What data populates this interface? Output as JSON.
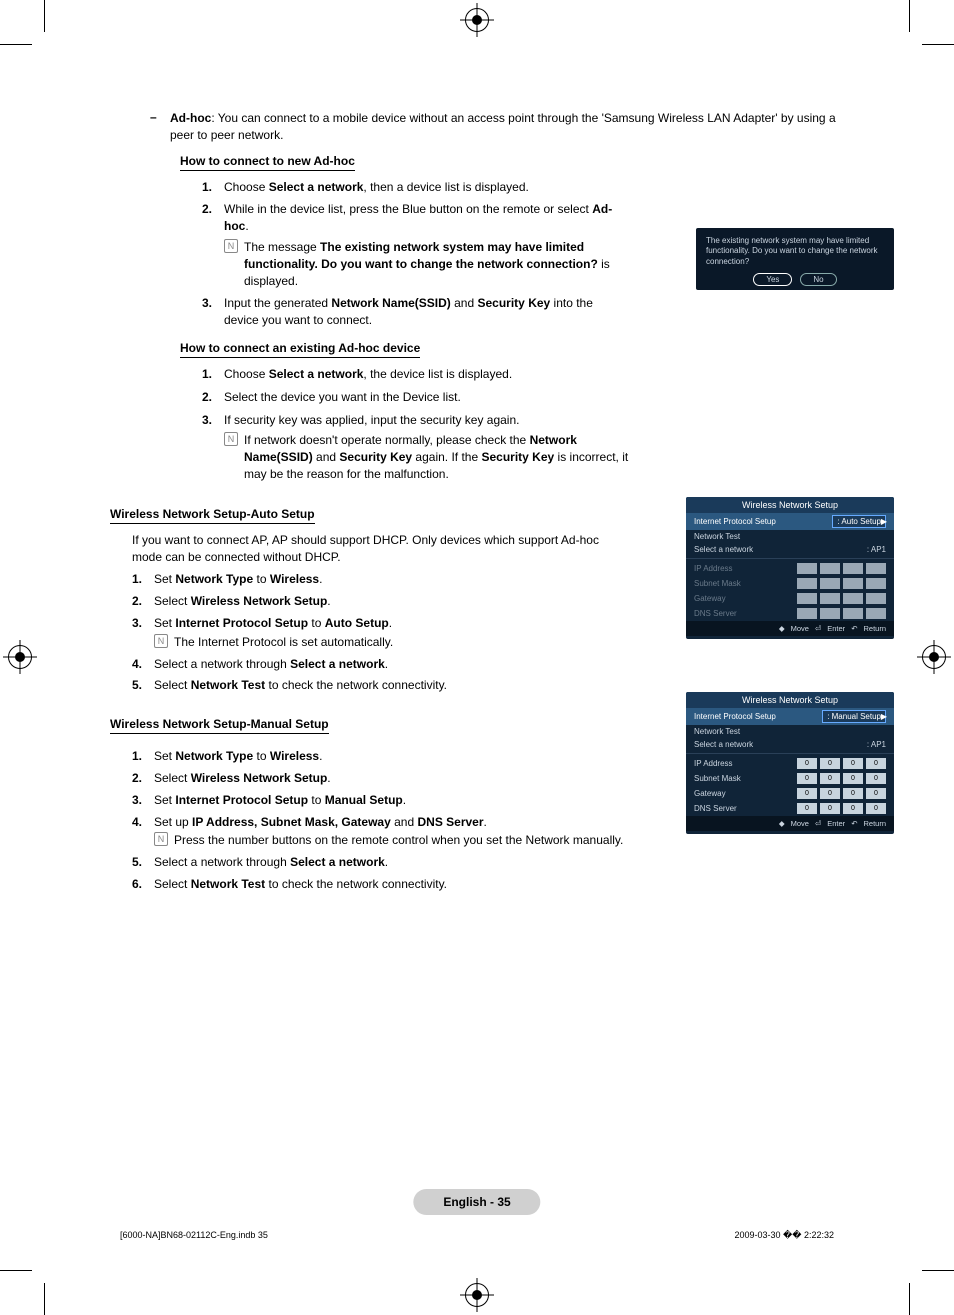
{
  "adhoc_intro": {
    "label": "Ad-hoc",
    "text": ": You can connect to a mobile device without an access point through the 'Samsung Wireless LAN Adapter' by using a peer to peer network."
  },
  "section1": {
    "heading": "How to connect to new Ad-hoc",
    "steps": {
      "s1": {
        "n": "1.",
        "pre": "Choose ",
        "b": "Select a network",
        "post": ", then a device list is displayed."
      },
      "s2": {
        "n": "2.",
        "pre": "While in the device list, press the Blue button on the remote or select ",
        "b": "Ad-hoc",
        "post": "."
      },
      "s2note": {
        "pre": "The message ",
        "b": "The existing network system may have limited functionality. Do you want to change the network connection?",
        "post": " is displayed."
      },
      "s3": {
        "n": "3.",
        "pre": "Input the generated ",
        "b1": "Network Name(SSID)",
        "mid": " and ",
        "b2": "Security Key",
        "post": " into the device you want to connect."
      }
    }
  },
  "section2": {
    "heading": "How to connect an existing Ad-hoc device",
    "steps": {
      "s1": {
        "n": "1.",
        "pre": "Choose ",
        "b": "Select a network",
        "post": ", the device list is displayed."
      },
      "s2": {
        "n": "2.",
        "text": "Select the device you want in the Device list."
      },
      "s3": {
        "n": "3.",
        "text": "If security key was applied, input the security key again."
      },
      "s3note": {
        "pre": "If network doesn't operate normally, please check the ",
        "b1": "Network Name(SSID)",
        "m1": " and ",
        "b2": "Security Key",
        "m2": " again. If the ",
        "b3": "Security Key",
        "post": " is incorrect, it may be the reason for the malfunction."
      }
    }
  },
  "auto": {
    "title": "Wireless Network Setup-Auto Setup",
    "intro": "If you want to connect AP, AP should support DHCP. Only devices which support Ad-hoc mode can be connected without DHCP.",
    "s1": {
      "n": "1.",
      "pre": "Set ",
      "b1": "Network Type",
      "m": " to ",
      "b2": "Wireless",
      "post": "."
    },
    "s2": {
      "n": "2.",
      "pre": "Select ",
      "b": "Wireless Network Setup",
      "post": "."
    },
    "s3": {
      "n": "3.",
      "pre": "Set ",
      "b1": "Internet Protocol Setup",
      "m": " to ",
      "b2": "Auto Setup",
      "post": "."
    },
    "s3note": "The Internet Protocol is set automatically.",
    "s4": {
      "n": "4.",
      "pre": "Select a network through ",
      "b": "Select a network",
      "post": "."
    },
    "s5": {
      "n": "5.",
      "pre": "Select ",
      "b": "Network Test",
      "post": " to check the network connectivity."
    }
  },
  "manual": {
    "title": "Wireless Network Setup-Manual Setup",
    "s1": {
      "n": "1.",
      "pre": "Set ",
      "b1": "Network Type",
      "m": " to ",
      "b2": "Wireless",
      "post": "."
    },
    "s2": {
      "n": "2.",
      "pre": "Select ",
      "b": "Wireless Network Setup",
      "post": "."
    },
    "s3": {
      "n": "3.",
      "pre": "Set ",
      "b1": "Internet Protocol Setup",
      "m": " to ",
      "b2": "Manual Setup",
      "post": "."
    },
    "s4": {
      "n": "4.",
      "pre": "Set up ",
      "b": "IP Address, Subnet Mask, Gateway",
      "m": " and ",
      "b2": "DNS Server",
      "post": "."
    },
    "s4note": "Press the number buttons on the remote control when you set the Network manually.",
    "s5": {
      "n": "5.",
      "pre": "Select a network through ",
      "b": "Select a network",
      "post": "."
    },
    "s6": {
      "n": "6.",
      "pre": "Select ",
      "b": "Network Test",
      "post": " to check the network connectivity."
    }
  },
  "dialog": {
    "msg": "The existing network system may have limited functionality. Do you want to change the network connection?",
    "yes": "Yes",
    "no": "No"
  },
  "panel": {
    "title": "Wireless Network Setup",
    "ips": "Internet Protocol Setup",
    "auto_val": ": Auto Setup",
    "manual_val": ": Manual Setup",
    "ntest": "Network Test",
    "sel": "Select a network",
    "ap": ": AP1",
    "ip": "IP Address",
    "mask": "Subnet Mask",
    "gw": "Gateway",
    "dns": "DNS Server",
    "foot_move": "Move",
    "foot_enter": "Enter",
    "foot_return": "Return",
    "vals": {
      "ip": [
        "0",
        "0",
        "0",
        "0"
      ],
      "mask": [
        "0",
        "0",
        "0",
        "0"
      ],
      "gw": [
        "0",
        "0",
        "0",
        "0"
      ],
      "dns": [
        "0",
        "0",
        "0",
        "0"
      ]
    }
  },
  "footer": {
    "page": "English - 35",
    "file": "[6000-NA]BN68-02112C-Eng.indb   35",
    "date": "2009-03-30   �� 2:22:32"
  }
}
